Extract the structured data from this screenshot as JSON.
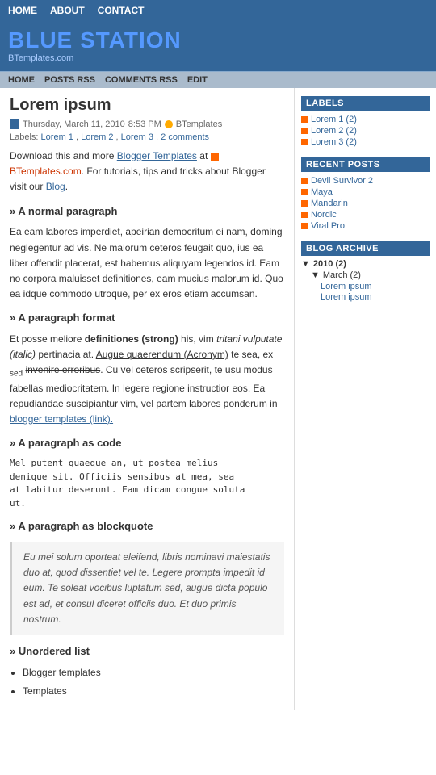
{
  "topnav": {
    "items": [
      "HOME",
      "ABOUT",
      "CONTACT"
    ]
  },
  "header": {
    "title": "BLUE STATION",
    "subtitle": "BTemplates.com"
  },
  "secnav": {
    "items": [
      "HOME",
      "POSTS RSS",
      "COMMENTS RSS",
      "EDIT"
    ]
  },
  "post": {
    "title": "Lorem ipsum",
    "date": "Thursday, March 11, 2010",
    "time": "8:53 PM",
    "author": "BTemplates",
    "labels": {
      "prefix": "Labels:",
      "items": [
        "Lorem 1",
        "Lorem 2",
        "Lorem 3",
        "2 comments"
      ]
    },
    "intro": "Download this and more",
    "link_text": "Blogger Templates",
    "link_suffix": "at",
    "templates_text": "BTemplates.com",
    "templates_suffix": ".  For tutorials, tips and tricks about Blogger visit our",
    "blog_link": "Blog",
    "sections": [
      {
        "id": "s1",
        "header": "» A normal paragraph",
        "body": "Ea eam labores imperdiet, apeirian democritum ei nam, doming neglegentur ad vis. Ne malorum ceteros feugait quo, ius ea liber offendit placerat, est habemus aliquyam legendos id. Eam no corpora maluisset definitiones, eam mucius malorum id. Quo ea idque commodo utroque, per ex eros etiam accumsan."
      },
      {
        "id": "s2",
        "header": "» A paragraph format",
        "body_parts": {
          "text1": "Et posse meliore ",
          "strong": "definitiones (strong)",
          "text2": " his, vim ",
          "italic": "tritani vulputate (italic)",
          "text3": " pertinacia at. ",
          "underline": "Augue quaerendum (Acronym)",
          "text4": " te sea, ex",
          "sub": "sed",
          "text5": " ",
          "strikethrough": "invenire erroribus",
          "text6": ". Cu vel ceteros scripserit, te usu modus fabellas mediocritatem. In legere regione instructior eos. Ea repudiandae suscipiantur vim, vel partem labores ponderum in ",
          "link": "blogger templates (link).",
          "link_href": "#"
        }
      },
      {
        "id": "s3",
        "header": "» A paragraph as code",
        "code": "Mel putent quaeque an, ut postea melius\ndenique sit. Officiis sensibus at mea, sea\nat labitur deserunt. Eam dicam congue soluta\nut."
      },
      {
        "id": "s4",
        "header": "» A paragraph as blockquote",
        "quote": "Eu mei solum oporteat eleifend, libris nominavi maiestatis duo at, quod dissentiet vel te. Legere prompta impedit id eum. Te soleat vocibus luptatum sed, augue dicta populo est ad, et consul diceret officiis duo. Et duo primis nostrum."
      },
      {
        "id": "s5",
        "header": "» Unordered list",
        "list_items": [
          "Blogger templates",
          "Templates"
        ]
      }
    ]
  },
  "sidebar": {
    "labels_title": "LABELS",
    "labels": [
      {
        "text": "Lorem 1",
        "count": "(2)"
      },
      {
        "text": "Lorem 2",
        "count": "(2)"
      },
      {
        "text": "Lorem 3",
        "count": "(2)"
      }
    ],
    "recent_title": "RECENT POSTS",
    "recent": [
      {
        "text": "Devil Survivor 2"
      },
      {
        "text": "Maya"
      },
      {
        "text": "Mandarin"
      },
      {
        "text": "Nordic"
      },
      {
        "text": "Viral Pro"
      }
    ],
    "archive_title": "BLOG ARCHIVE",
    "archive": [
      {
        "year": "2010",
        "count": "(2)",
        "months": [
          {
            "name": "March",
            "count": "(2)",
            "posts": [
              "Lorem ipsum",
              "Lorem ipsum"
            ]
          }
        ]
      }
    ]
  }
}
